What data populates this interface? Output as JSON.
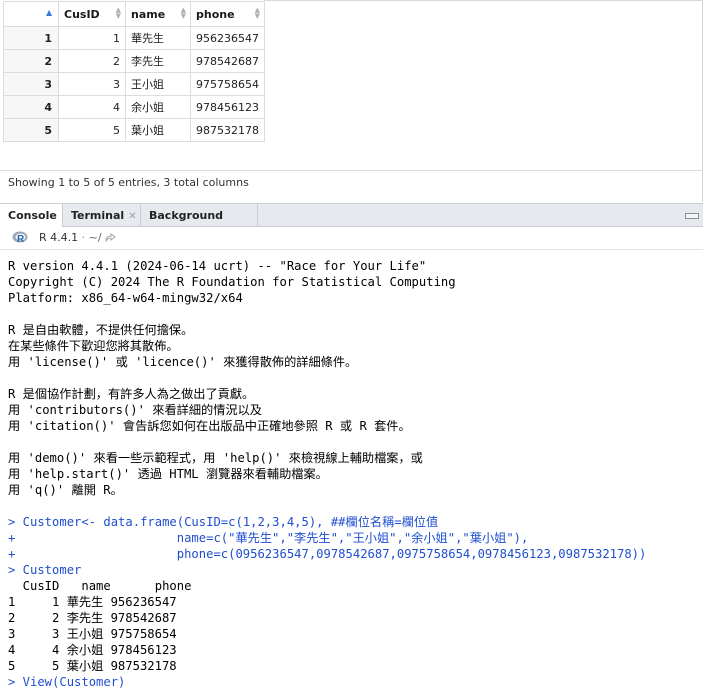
{
  "viewer": {
    "columns": [
      "CusID",
      "name",
      "phone"
    ],
    "rows": [
      {
        "rn": "1",
        "id": "1",
        "name": "華先生",
        "phone": "956236547"
      },
      {
        "rn": "2",
        "id": "2",
        "name": "李先生",
        "phone": "978542687"
      },
      {
        "rn": "3",
        "id": "3",
        "name": "王小姐",
        "phone": "975758654"
      },
      {
        "rn": "4",
        "id": "4",
        "name": "余小姐",
        "phone": "978456123"
      },
      {
        "rn": "5",
        "id": "5",
        "name": "葉小姐",
        "phone": "987532178"
      }
    ],
    "status": "Showing 1 to 5 of 5 entries, 3 total columns"
  },
  "tabs": [
    {
      "label": "Console",
      "closable": false
    },
    {
      "label": "Terminal",
      "closable": true
    },
    {
      "label": "Background Jobs",
      "closable": true
    }
  ],
  "path": {
    "version": "R 4.4.1",
    "dir": "~/"
  },
  "console": {
    "lines": [
      {
        "t": "R version 4.4.1 (2024-06-14 ucrt) -- \"Race for Your Life\"",
        "type": "out"
      },
      {
        "t": "Copyright (C) 2024 The R Foundation for Statistical Computing",
        "type": "out"
      },
      {
        "t": "Platform: x86_64-w64-mingw32/x64",
        "type": "out"
      },
      {
        "t": "",
        "type": "out"
      },
      {
        "t": "R 是自由軟體，不提供任何擔保。",
        "type": "out"
      },
      {
        "t": "在某些條件下歡迎您將其散佈。",
        "type": "out"
      },
      {
        "t": "用 'license()' 或 'licence()' 來獲得散佈的詳細條件。",
        "type": "out"
      },
      {
        "t": "",
        "type": "out"
      },
      {
        "t": "R 是個協作計劃，有許多人為之做出了貢獻。",
        "type": "out"
      },
      {
        "t": "用 'contributors()' 來看詳細的情況以及",
        "type": "out"
      },
      {
        "t": "用 'citation()' 會告訴您如何在出版品中正確地參照 R 或 R 套件。",
        "type": "out"
      },
      {
        "t": "",
        "type": "out"
      },
      {
        "t": "用 'demo()' 來看一些示範程式，用 'help()' 來檢視線上輔助檔案，或",
        "type": "out"
      },
      {
        "t": "用 'help.start()' 透過 HTML 瀏覽器來看輔助檔案。",
        "type": "out"
      },
      {
        "t": "用 'q()' 離開 R。",
        "type": "out"
      },
      {
        "t": "",
        "type": "out"
      },
      {
        "t": "> Customer<- data.frame(CusID=c(1,2,3,4,5), ##欄位名稱=欄位值",
        "type": "in"
      },
      {
        "t": "+                      name=c(\"華先生\",\"李先生\",\"王小姐\",\"余小姐\",\"葉小姐\"),",
        "type": "in"
      },
      {
        "t": "+                      phone=c(0956236547,0978542687,0975758654,0978456123,0987532178))",
        "type": "in"
      },
      {
        "t": "> Customer",
        "type": "in"
      },
      {
        "t": "  CusID   name      phone",
        "type": "out"
      },
      {
        "t": "1     1 華先生 956236547",
        "type": "out"
      },
      {
        "t": "2     2 李先生 978542687",
        "type": "out"
      },
      {
        "t": "3     3 王小姐 975758654",
        "type": "out"
      },
      {
        "t": "4     4 余小姐 978456123",
        "type": "out"
      },
      {
        "t": "5     5 葉小姐 987532178",
        "type": "out"
      },
      {
        "t": "> View(Customer)",
        "type": "in"
      }
    ]
  },
  "colors": {
    "input": "#1f4fd0",
    "tabbar": "#e6eaee",
    "sort_active": "#3c78d8"
  }
}
